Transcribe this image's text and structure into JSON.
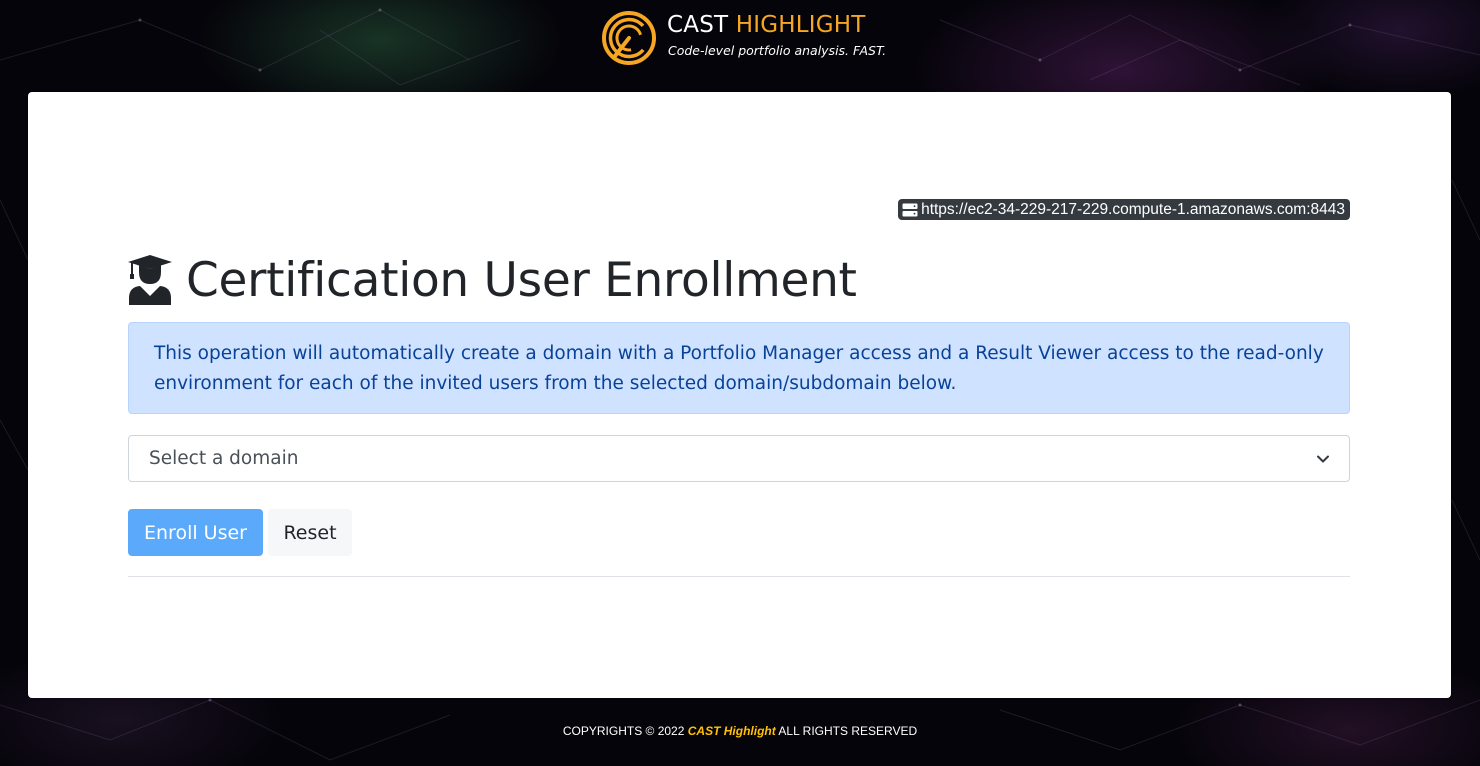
{
  "header": {
    "brand_name_primary": "CAST",
    "brand_name_highlight": "HIGHLIGHT",
    "tagline": "Code-level portfolio analysis. FAST.",
    "logo_icon": "cast-highlight-logo-icon"
  },
  "server": {
    "icon": "server-icon",
    "url": "https://ec2-34-229-217-229.compute-1.amazonaws.com:8443"
  },
  "page": {
    "icon": "user-graduate-icon",
    "title": "Certification User Enrollment"
  },
  "alert": {
    "text": "This operation will automatically create a domain with a Portfolio Manager access and a Result Viewer access to the read-only environment for each of the invited users from the selected domain/subdomain below."
  },
  "domain_select": {
    "selected": "Select a domain",
    "icon": "chevron-down-icon"
  },
  "buttons": {
    "enroll": "Enroll User",
    "reset": "Reset"
  },
  "footer": {
    "prefix": "COPYRIGHTS © 2022",
    "brand": "CAST Highlight",
    "suffix": "ALL RIGHTS RESERVED"
  },
  "colors": {
    "brand_orange": "#f5a623",
    "footer_brand": "#ffc107",
    "alert_bg": "#cfe2ff",
    "alert_text": "#084298",
    "enroll_button": "#5aa9fa",
    "badge_bg": "#343a40"
  }
}
